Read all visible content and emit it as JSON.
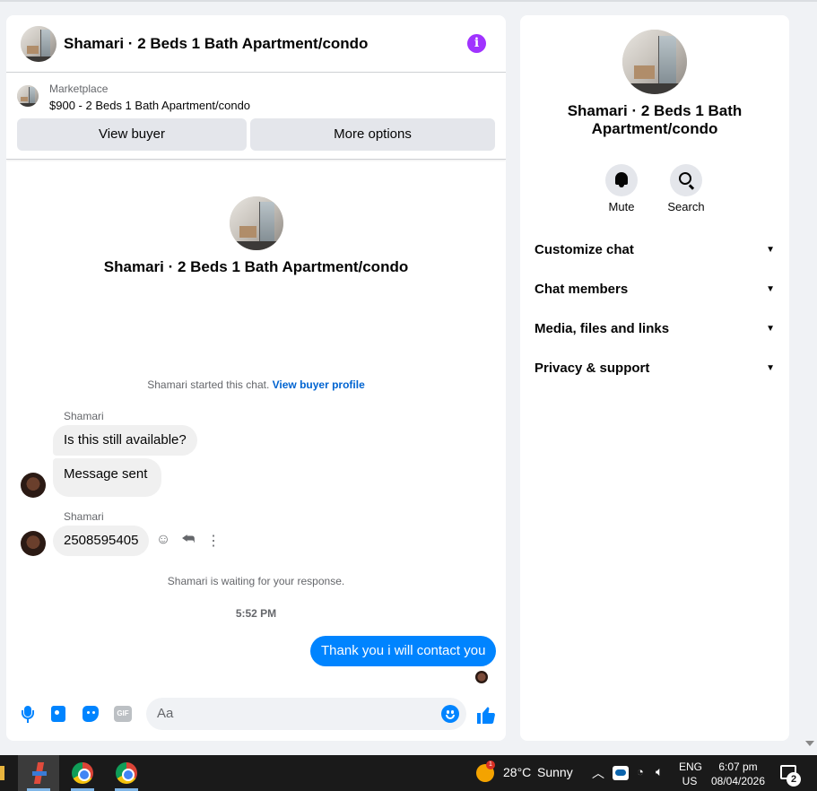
{
  "chat": {
    "title": "Shamari · 2 Beds 1 Bath Apartment/condo",
    "listing": {
      "label": "Marketplace",
      "price_line": "$900 - 2 Beds 1 Bath Apartment/condo",
      "view_buyer": "View buyer",
      "more_options": "More options"
    },
    "intro_title": "Shamari · 2 Beds 1 Bath Apartment/condo",
    "started_text": "Shamari started this chat.",
    "started_link": "View buyer profile",
    "messages": [
      {
        "sender": "Shamari",
        "text": "Is this still available?"
      },
      {
        "text": "Message sent"
      },
      {
        "sender": "Shamari",
        "text": "2508595405"
      }
    ],
    "waiting_text": "Shamari is waiting for your response.",
    "timestamp": "5:52 PM",
    "my_message": "Thank you i will contact you",
    "composer_placeholder": "Aa",
    "gif_label": "GIF",
    "accent_color": "#0084ff",
    "info_color": "#a033ff"
  },
  "side": {
    "title": "Shamari · 2 Beds 1 Bath Apartment/condo",
    "mute": "Mute",
    "search": "Search",
    "sections": [
      "Customize chat",
      "Chat members",
      "Media, files and links",
      "Privacy & support"
    ]
  },
  "taskbar": {
    "temperature": "28°C",
    "weather": "Sunny",
    "weather_badge": "1",
    "lang_top": "ENG",
    "lang_bottom": "US",
    "time": "6:07 pm",
    "date": "08/04/2026",
    "notifications": "2"
  }
}
